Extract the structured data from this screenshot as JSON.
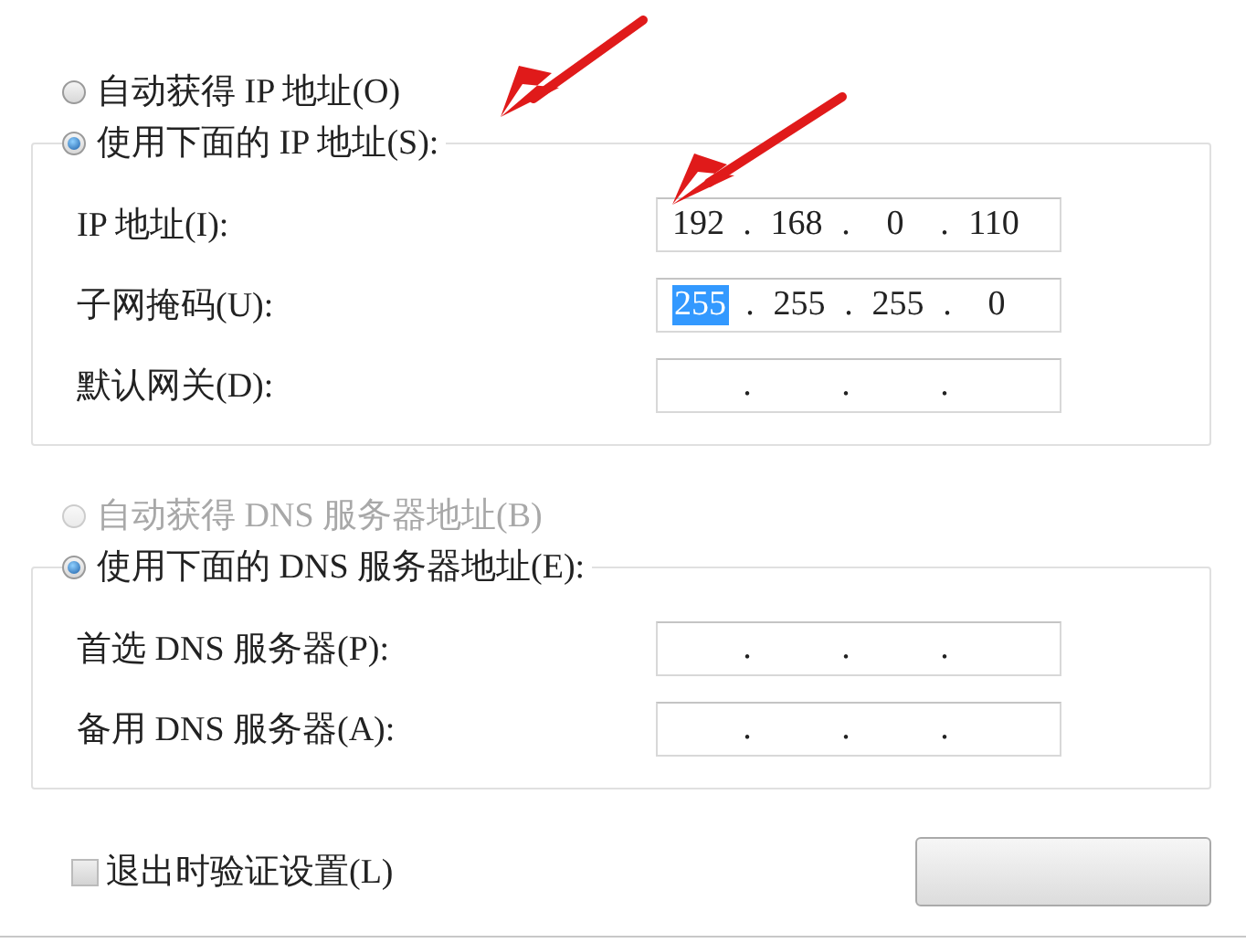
{
  "ip_section": {
    "radios": [
      {
        "label": "自动获得 IP 地址(O)",
        "selected": false,
        "disabled": false
      },
      {
        "label": "使用下面的 IP 地址(S):",
        "selected": true,
        "disabled": false
      }
    ],
    "fields": [
      {
        "label": "IP 地址(I):",
        "segments": [
          {
            "text": "192",
            "selected": false
          },
          {
            "text": "168",
            "selected": false
          },
          {
            "text": "0",
            "selected": false
          },
          {
            "text": "110",
            "selected": false
          }
        ],
        "dots": [
          ".",
          ".",
          "."
        ]
      },
      {
        "label": "子网掩码(U):",
        "segments": [
          {
            "text": "255",
            "selected": true
          },
          {
            "text": "255",
            "selected": false
          },
          {
            "text": "255",
            "selected": false
          },
          {
            "text": "0",
            "selected": false
          }
        ],
        "dots": [
          ".",
          ".",
          "."
        ]
      },
      {
        "label": "默认网关(D):",
        "segments": [
          {
            "selected": false
          },
          {
            "selected": false
          },
          {
            "selected": false
          },
          {
            "selected": false
          }
        ],
        "dots": [
          ".",
          ".",
          "."
        ]
      }
    ]
  },
  "dns_section": {
    "radios": [
      {
        "label": "自动获得 DNS 服务器地址(B)",
        "selected": false,
        "disabled": true
      },
      {
        "label": "使用下面的 DNS 服务器地址(E):",
        "selected": true,
        "disabled": false
      }
    ],
    "fields": [
      {
        "label": "首选 DNS 服务器(P):",
        "segments": [
          {
            "selected": false
          },
          {
            "selected": false
          },
          {
            "selected": false
          },
          {
            "selected": false
          }
        ],
        "dots": [
          ".",
          ".",
          "."
        ]
      },
      {
        "label": "备用 DNS 服务器(A):",
        "segments": [
          {
            "selected": false
          },
          {
            "selected": false
          },
          {
            "selected": false
          },
          {
            "selected": false
          }
        ],
        "dots": [
          ".",
          ".",
          "."
        ]
      }
    ]
  },
  "validate_checkbox": {
    "label": "退出时验证设置(L)",
    "checked": false
  }
}
